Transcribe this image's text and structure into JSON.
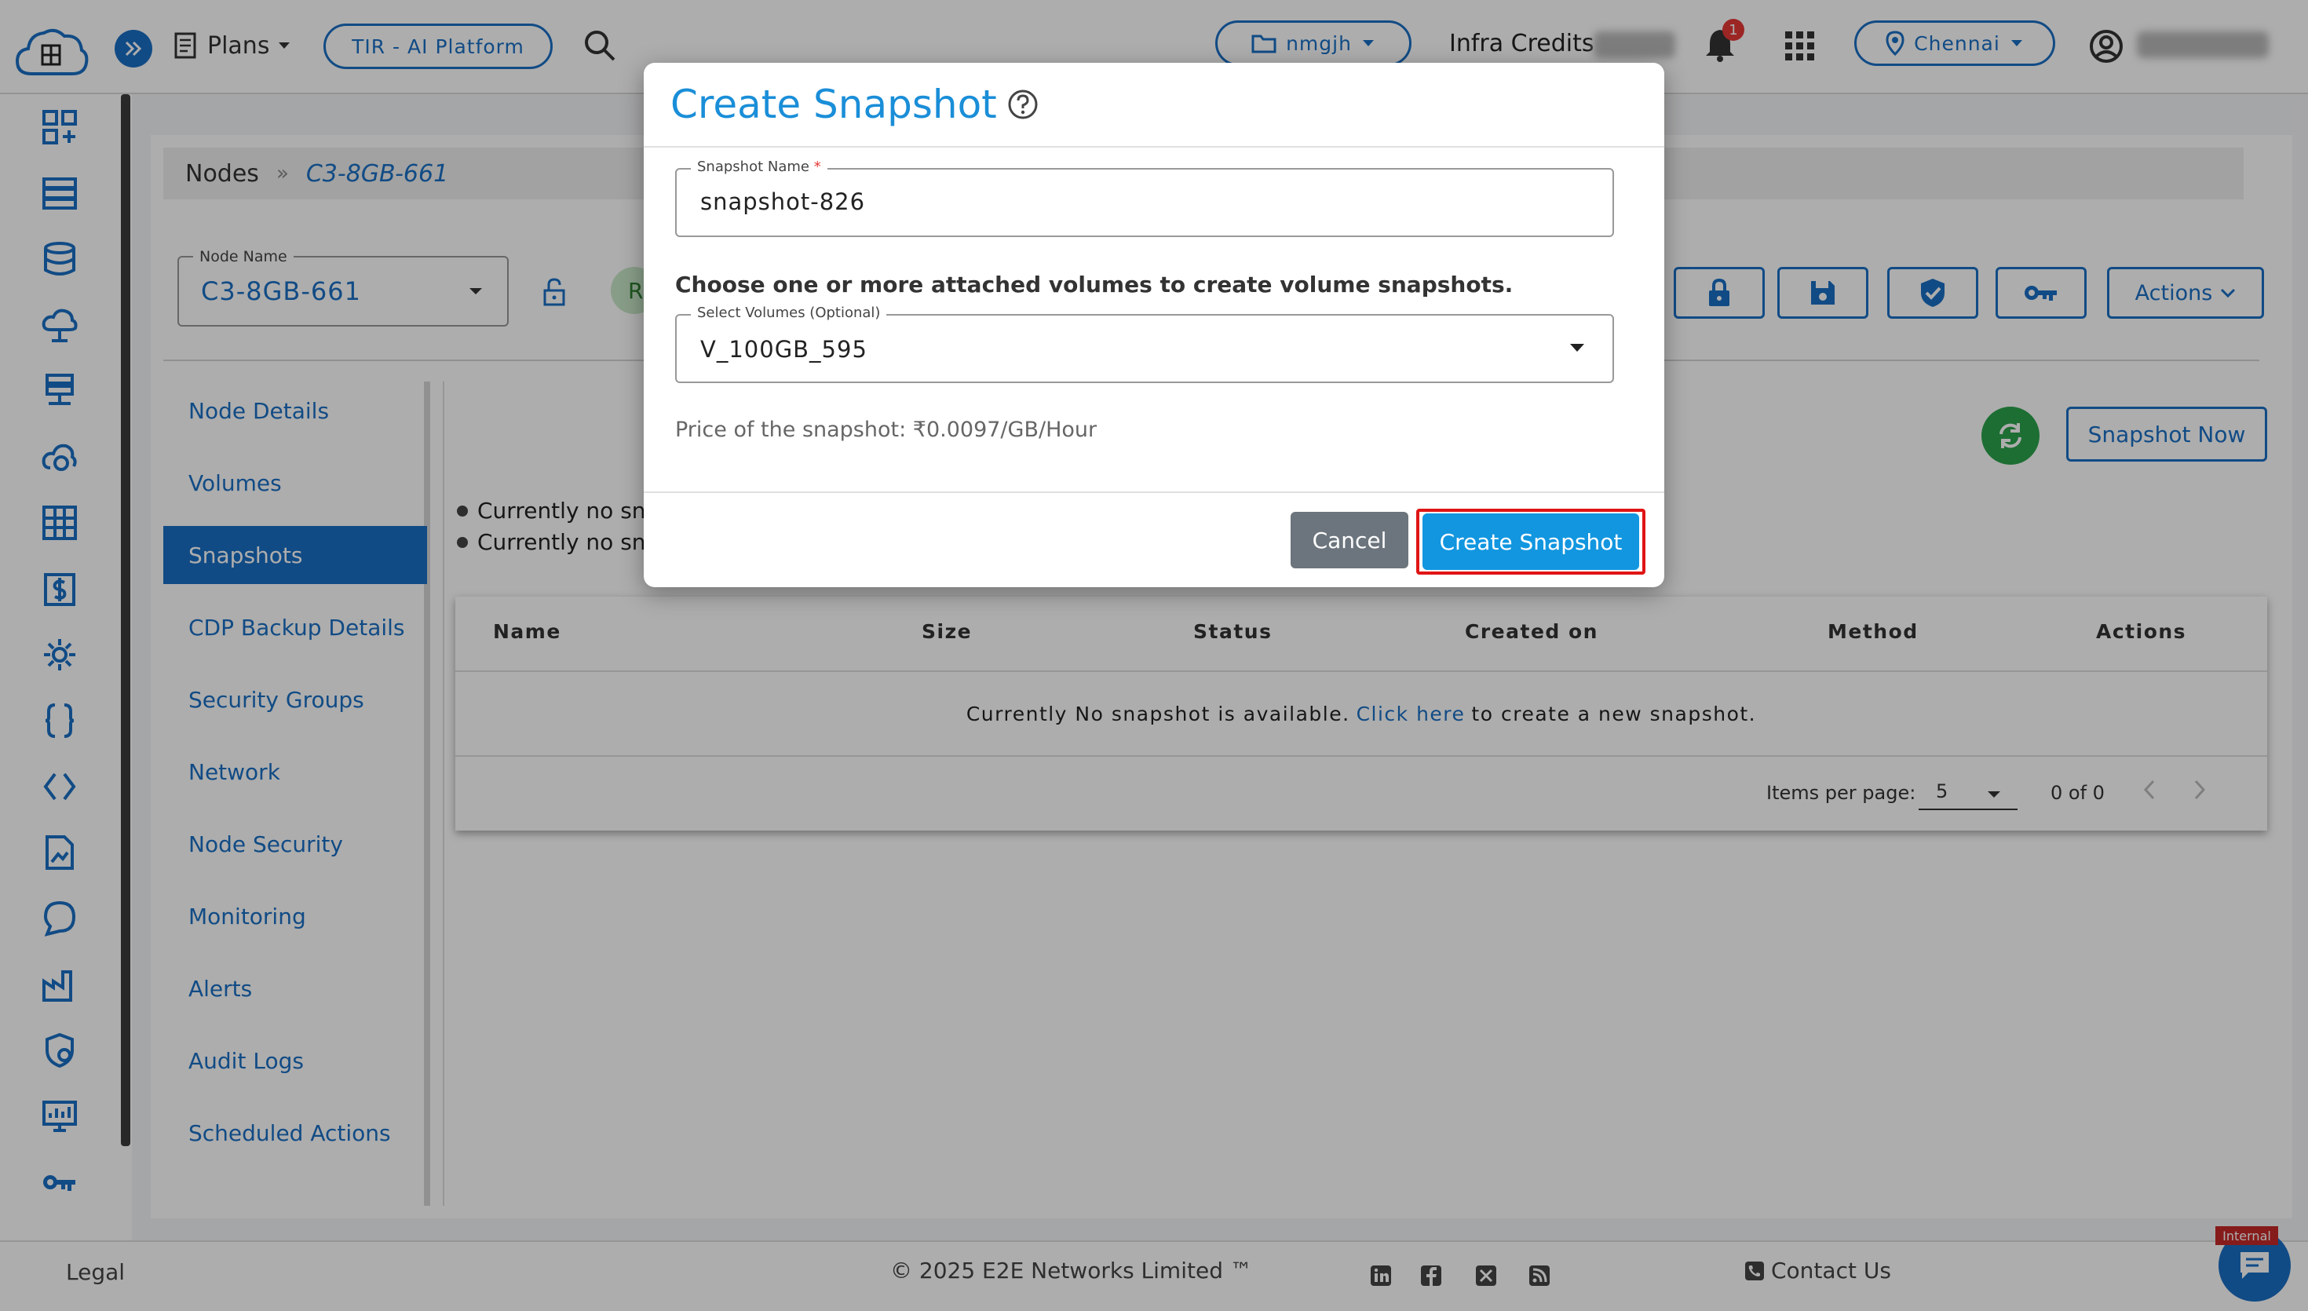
{
  "topbar": {
    "plans_label": "Plans",
    "tir_label": "TIR - AI Platform",
    "project_label": "nmgjh",
    "credits_label": "Infra Credits",
    "notifications_count": "1",
    "location_label": "Chennai"
  },
  "breadcrumb": {
    "root": "Nodes",
    "separator": "»",
    "current": "C3-8GB-661"
  },
  "node_selector": {
    "label": "Node Name",
    "value": "C3-8GB-661",
    "status_initial": "R"
  },
  "toolbar": {
    "actions_label": "Actions"
  },
  "side_menu": {
    "items": [
      {
        "label": "Node Details"
      },
      {
        "label": "Volumes"
      },
      {
        "label": "Snapshots"
      },
      {
        "label": "CDP Backup Details"
      },
      {
        "label": "Security Groups"
      },
      {
        "label": "Network"
      },
      {
        "label": "Node Security"
      },
      {
        "label": "Monitoring"
      },
      {
        "label": "Alerts"
      },
      {
        "label": "Audit Logs"
      },
      {
        "label": "Scheduled Actions"
      }
    ],
    "active_index": 2
  },
  "snapshots": {
    "snapshot_now_label": "Snapshot Now",
    "notes": [
      "Currently no sna",
      "Currently no sna"
    ],
    "table": {
      "columns": [
        "Name",
        "Size",
        "Status",
        "Created on",
        "Method",
        "Actions"
      ],
      "empty_prefix": "Currently No snapshot is available.",
      "empty_link": "Click here",
      "empty_suffix": "to create a new snapshot.",
      "items_per_page_label": "Items per page:",
      "items_per_page_value": "5",
      "range_label": "0 of 0"
    }
  },
  "modal": {
    "title": "Create Snapshot",
    "snapshot_name_label": "Snapshot Name",
    "snapshot_name_required": "*",
    "snapshot_name_value": "snapshot-826",
    "choose_text": "Choose one or more attached volumes to create volume snapshots.",
    "volumes_label": "Select Volumes (Optional)",
    "volumes_value": "V_100GB_595",
    "price_text": "Price of the snapshot: ₹0.0097/GB/Hour",
    "cancel_label": "Cancel",
    "create_label": "Create Snapshot"
  },
  "footer": {
    "legal": "Legal",
    "copyright": "© 2025 E2E Networks Limited ™",
    "contact": "Contact Us",
    "internal_tag": "Internal"
  },
  "colors": {
    "primary": "#1a6fc4",
    "modal_title": "#1a8ed8",
    "create_button": "#1296e0",
    "cancel_button": "#6c757d",
    "highlight": "#e01515",
    "refresh": "#2ba24c"
  }
}
